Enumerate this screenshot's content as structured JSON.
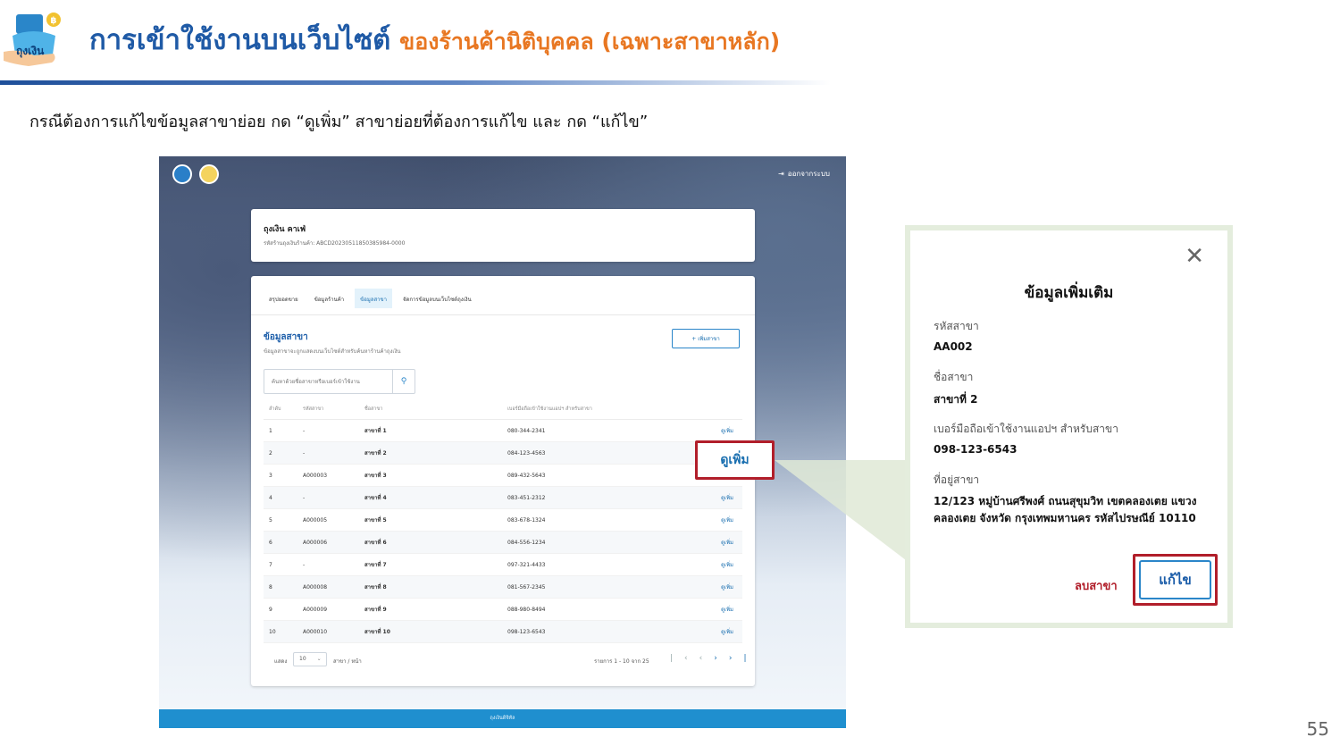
{
  "slide": {
    "logo_text": "ถุงเงิน",
    "title_main": "การเข้าใช้งานบนเว็บไซต์",
    "title_sub": "ของร้านค้านิติบุคคล (เฉพาะสาขาหลัก)",
    "instruction": "กรณีต้องการแก้ไขข้อมูลสาขาย่อย กด “ดูเพิ่ม” สาขาย่อยที่ต้องการแก้ไข และ กด “แก้ไข”",
    "page_number": "55"
  },
  "screen": {
    "logout_label": "ออกจากระบบ",
    "store_name": "ถุงเงิน คาเฟ่",
    "store_code": "รหัสร้านถุงเงินร้านค้า: ABCD20230511850385984-0000",
    "tabs": [
      "สรุปยอดขาย",
      "ข้อมูลร้านค้า",
      "ข้อมูลสาขา",
      "จัดการข้อมูลบนเว็บไซต์ถุงเงิน"
    ],
    "active_tab": "ข้อมูลสาขา",
    "section_title": "ข้อมูลสาขา",
    "section_desc": "ข้อมูลสาขาจะถูกแสดงบนเว็บไซต์สำหรับค้นหาร้านค้าถุงเงิน",
    "add_branch_label": "+ เพิ่มสาขา",
    "search_placeholder": "ค้นหาด้วยชื่อสาขาหรือเบอร์เข้าใช้งาน",
    "table": {
      "headers": [
        "ลำดับ",
        "รหัสสาขา",
        "ชื่อสาขา",
        "เบอร์มือถือเข้าใช้งานแอปฯ สำหรับสาขา",
        ""
      ],
      "rows": [
        [
          "1",
          "-",
          "สาขาที่ 1",
          "080-344-2341",
          "ดูเพิ่ม"
        ],
        [
          "2",
          "-",
          "สาขาที่ 2",
          "084-123-4563",
          "ดูเพิ่ม"
        ],
        [
          "3",
          "A000003",
          "สาขาที่ 3",
          "089-432-5643",
          "ดูเพิ่ม"
        ],
        [
          "4",
          "-",
          "สาขาที่ 4",
          "083-451-2312",
          "ดูเพิ่ม"
        ],
        [
          "5",
          "A000005",
          "สาขาที่ 5",
          "083-678-1324",
          "ดูเพิ่ม"
        ],
        [
          "6",
          "A000006",
          "สาขาที่ 6",
          "084-556-1234",
          "ดูเพิ่ม"
        ],
        [
          "7",
          "-",
          "สาขาที่ 7",
          "097-321-4433",
          "ดูเพิ่ม"
        ],
        [
          "8",
          "A000008",
          "สาขาที่ 8",
          "081-567-2345",
          "ดูเพิ่ม"
        ],
        [
          "9",
          "A000009",
          "สาขาที่ 9",
          "088-980-8494",
          "ดูเพิ่ม"
        ],
        [
          "10",
          "A000010",
          "สาขาที่ 10",
          "098-123-6543",
          "ดูเพิ่ม"
        ]
      ]
    },
    "pager": {
      "show_label": "แสดง",
      "page_size": "10",
      "unit_label": "สาขา / หน้า",
      "range_label": "รายการ 1 - 10 จาก 25",
      "nav_icons": [
        "first-page-icon",
        "prev-page-icon",
        "next-page-icon",
        "last-page-icon"
      ]
    },
    "footer_text": "ถุงเงินดิจิทัล"
  },
  "callout": {
    "more_label": "ดูเพิ่ม"
  },
  "modal": {
    "title": "ข้อมูลเพิ่มเติม",
    "code_label": "รหัสสาขา",
    "code_value": "AA002",
    "name_label": "ชื่อสาขา",
    "name_value": "สาขาที่ 2",
    "phone_label": "เบอร์มือถือเข้าใช้งานแอปฯ สำหรับสาขา",
    "phone_value": "098-123-6543",
    "address_label": "ที่อยู่สาขา",
    "address_value": "12/123 หมู่บ้านศรีพงศ์ ถนนสุขุมวิท เขตคลองเตย แขวงคลองเตย จังหวัด กรุงเทพมหานคร รหัสไปรษณีย์ 10110",
    "delete_label": "ลบสาขา",
    "edit_label": "แก้ไข"
  },
  "colors": {
    "title_blue": "#1f5aa6",
    "title_orange": "#e87722",
    "highlight_red": "#b11e2a",
    "link_blue": "#1a6fb0",
    "footer_blue": "#1f8fcf"
  }
}
